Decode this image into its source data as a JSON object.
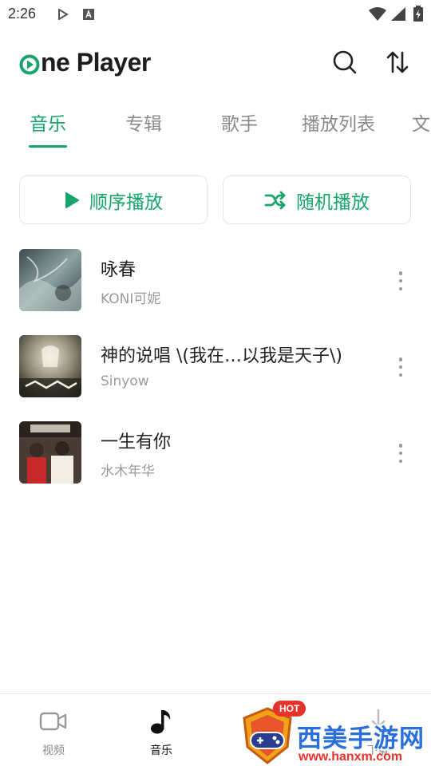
{
  "status_bar": {
    "time": "2:26"
  },
  "app": {
    "logo_text": "ne Player"
  },
  "tabs": [
    {
      "label": "音乐",
      "active": true
    },
    {
      "label": "专辑"
    },
    {
      "label": "歌手"
    },
    {
      "label": "播放列表"
    },
    {
      "label": "文"
    }
  ],
  "actions": {
    "sequential_label": "顺序播放",
    "shuffle_label": "随机播放"
  },
  "songs": [
    {
      "title": "咏春",
      "artist": "KONI可妮"
    },
    {
      "title": "神的说唱 \\(我在…以我是天子\\)",
      "artist": "Sinyow"
    },
    {
      "title": "一生有你",
      "artist": "水木年华"
    }
  ],
  "bottom_nav": [
    {
      "label": "视频",
      "icon": "video-camera-icon"
    },
    {
      "label": "音乐",
      "icon": "music-note-icon",
      "active": true
    },
    {
      "label": "下载",
      "icon": "download-icon"
    }
  ],
  "watermark": {
    "badge": "HOT",
    "title": "西美手游网",
    "url": "www.hanxm.com"
  },
  "colors": {
    "accent": "#16a56a",
    "text": "#222222",
    "muted": "#9a9a9a"
  }
}
